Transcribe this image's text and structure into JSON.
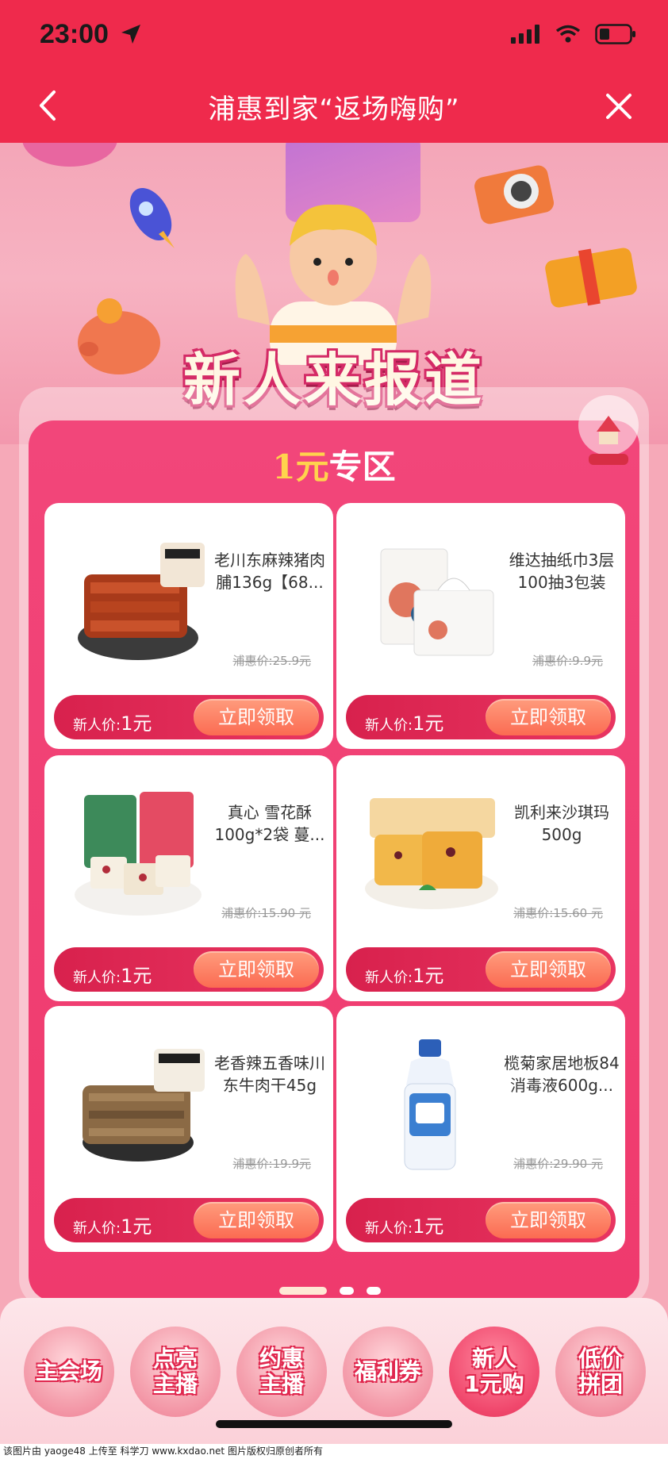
{
  "status_bar": {
    "time": "23:00"
  },
  "nav": {
    "title": "浦惠到家“返场嗨购”"
  },
  "hero": {
    "title": "新人来报道"
  },
  "section": {
    "title_highlight": "1元",
    "title_rest": "专区"
  },
  "products": [
    {
      "name": "老川东麻辣猪肉脯136g【68...",
      "orig_price": "浦惠价:25.9元",
      "new_label": "新人价:",
      "new_price": "1元",
      "claim": "立即领取",
      "thumb": "pork-jerky"
    },
    {
      "name": "维达抽纸巾3层100抽3包装",
      "orig_price": "浦惠价:9.9元",
      "new_label": "新人价:",
      "new_price": "1元",
      "claim": "立即领取",
      "thumb": "tissue"
    },
    {
      "name": "真心 雪花酥100g*2袋 蔓...",
      "orig_price": "浦惠价:15.90 元",
      "new_label": "新人价:",
      "new_price": "1元",
      "claim": "立即领取",
      "thumb": "snowflake-crisp"
    },
    {
      "name": "凯利来沙琪玛500g",
      "orig_price": "浦惠价:15.60 元",
      "new_label": "新人价:",
      "new_price": "1元",
      "claim": "立即领取",
      "thumb": "sachima"
    },
    {
      "name": "老香辣五香味川东牛肉干45g",
      "orig_price": "浦惠价:19.9元",
      "new_label": "新人价:",
      "new_price": "1元",
      "claim": "立即领取",
      "thumb": "beef-jerky"
    },
    {
      "name": "榄菊家居地板84消毒液600g...",
      "orig_price": "浦惠价:29.90 元",
      "new_label": "新人价:",
      "new_price": "1元",
      "claim": "立即领取",
      "thumb": "disinfectant"
    }
  ],
  "tabs": [
    {
      "label": "主会场"
    },
    {
      "label": "点亮\n主播"
    },
    {
      "label": "约惠\n主播"
    },
    {
      "label": "福利券"
    },
    {
      "label": "新人\n1元购",
      "active": true
    },
    {
      "label": "低价\n拼团"
    }
  ],
  "pagination": {
    "count": 3,
    "active": 0
  },
  "footer": {
    "text": "该图片由 yaoge48 上传至 科学刀 www.kxdao.net 图片版权归原创者所有"
  },
  "colors": {
    "brand": "#ef2a4c",
    "panel": "#f2467a",
    "claim_button": "#fb6b52",
    "price_highlight": "#ffd34d"
  }
}
